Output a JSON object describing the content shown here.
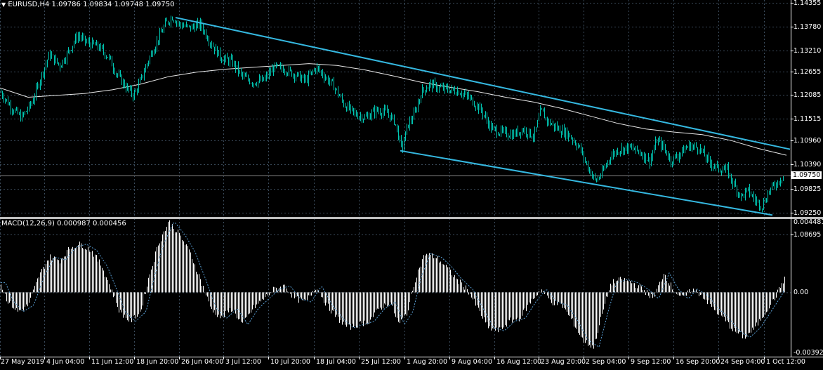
{
  "header": {
    "symbol_line": "EURUSD,H4  1.09786 1.09834 1.09748 1.09750",
    "macd_line": "MACD(12,26,9) 0.000987 0.000456"
  },
  "colors": {
    "background": "#000000",
    "grid": "#3a4a5a",
    "candle_up": "#00c8b4",
    "candle_down": "#00c8b4",
    "moving_average": "#e8e8e8",
    "trendline": "#35b8e0",
    "macd_histogram": "#ffffff",
    "macd_signal": "#5a9fd4",
    "price_tag_bg": "#ffffff",
    "price_tag_text": "#000000"
  },
  "chart_data": [
    {
      "type": "candlestick",
      "title": "EURUSD,H4",
      "ohlc_last": {
        "open": 1.09786,
        "high": 1.09834,
        "low": 1.09748,
        "close": 1.0975
      },
      "current_price": "1.09750",
      "ylim": [
        1.0865,
        1.1445
      ],
      "y_ticks": [
        "1.14355",
        "1.13780",
        "1.13210",
        "1.12655",
        "1.12085",
        "1.11515",
        "1.10960",
        "1.10390",
        "1.09825",
        "1.09250",
        "1.08695"
      ],
      "x_tick_labels": [
        "27 May 2019",
        "4 Jun 04:00",
        "11 Jun 12:00",
        "18 Jun 20:00",
        "26 Jun 04:00",
        "3 Jul 12:00",
        "10 Jul 20:00",
        "18 Jul 04:00",
        "25 Jul 12:00",
        "1 Aug 20:00",
        "9 Aug 04:00",
        "16 Aug 12:00",
        "23 Aug 20:00",
        "2 Sep 04:00",
        "9 Sep 12:00",
        "16 Sep 20:00",
        "24 Sep 04:00",
        "1 Oct 12:00"
      ],
      "close_path": [
        [
          0,
          1.12
        ],
        [
          15,
          1.116
        ],
        [
          30,
          1.113
        ],
        [
          45,
          1.117
        ],
        [
          60,
          1.125
        ],
        [
          70,
          1.13
        ],
        [
          85,
          1.127
        ],
        [
          95,
          1.13
        ],
        [
          110,
          1.135
        ],
        [
          125,
          1.133
        ],
        [
          140,
          1.132
        ],
        [
          155,
          1.129
        ],
        [
          165,
          1.125
        ],
        [
          180,
          1.121
        ],
        [
          190,
          1.119
        ],
        [
          200,
          1.123
        ],
        [
          210,
          1.128
        ],
        [
          222,
          1.133
        ],
        [
          235,
          1.138
        ],
        [
          245,
          1.14
        ],
        [
          255,
          1.138
        ],
        [
          270,
          1.137
        ],
        [
          285,
          1.138
        ],
        [
          300,
          1.133
        ],
        [
          315,
          1.129
        ],
        [
          330,
          1.128
        ],
        [
          345,
          1.124
        ],
        [
          360,
          1.1225
        ],
        [
          375,
          1.123
        ],
        [
          390,
          1.1265
        ],
        [
          405,
          1.126
        ],
        [
          420,
          1.1245
        ],
        [
          435,
          1.123
        ],
        [
          450,
          1.1265
        ],
        [
          460,
          1.1245
        ],
        [
          475,
          1.1215
        ],
        [
          490,
          1.1165
        ],
        [
          505,
          1.114
        ],
        [
          520,
          1.113
        ],
        [
          535,
          1.115
        ],
        [
          550,
          1.1145
        ],
        [
          562,
          1.112
        ],
        [
          572,
          1.1045
        ],
        [
          580,
          1.111
        ],
        [
          590,
          1.114
        ],
        [
          600,
          1.12
        ],
        [
          612,
          1.122
        ],
        [
          625,
          1.121
        ],
        [
          640,
          1.1205
        ],
        [
          655,
          1.12
        ],
        [
          670,
          1.118
        ],
        [
          685,
          1.115
        ],
        [
          700,
          1.11
        ],
        [
          715,
          1.109
        ],
        [
          730,
          1.1085
        ],
        [
          745,
          1.11
        ],
        [
          760,
          1.108
        ],
        [
          770,
          1.115
        ],
        [
          780,
          1.112
        ],
        [
          795,
          1.11
        ],
        [
          810,
          1.1085
        ],
        [
          825,
          1.105
        ],
        [
          835,
          1.1005
        ],
        [
          848,
          1.096
        ],
        [
          858,
          1.0985
        ],
        [
          868,
          1.1025
        ],
        [
          880,
          1.1045
        ],
        [
          895,
          1.105
        ],
        [
          910,
          1.104
        ],
        [
          925,
          1.1015
        ],
        [
          935,
          1.107
        ],
        [
          945,
          1.105
        ],
        [
          955,
          1.1015
        ],
        [
          965,
          1.103
        ],
        [
          980,
          1.1055
        ],
        [
          995,
          1.105
        ],
        [
          1010,
          1.101
        ],
        [
          1022,
          1.0995
        ],
        [
          1035,
          1.099
        ],
        [
          1045,
          1.095
        ],
        [
          1055,
          1.092
        ],
        [
          1065,
          1.0935
        ],
        [
          1075,
          1.091
        ],
        [
          1085,
          1.0895
        ],
        [
          1095,
          1.0935
        ],
        [
          1105,
          1.0955
        ],
        [
          1115,
          1.0975
        ]
      ],
      "moving_average": [
        [
          0,
          1.121
        ],
        [
          40,
          1.1185
        ],
        [
          80,
          1.119
        ],
        [
          120,
          1.1195
        ],
        [
          160,
          1.1205
        ],
        [
          200,
          1.122
        ],
        [
          240,
          1.124
        ],
        [
          280,
          1.1252
        ],
        [
          320,
          1.126
        ],
        [
          360,
          1.1265
        ],
        [
          400,
          1.127
        ],
        [
          440,
          1.1275
        ],
        [
          480,
          1.127
        ],
        [
          520,
          1.1258
        ],
        [
          560,
          1.1242
        ],
        [
          600,
          1.1225
        ],
        [
          640,
          1.1212
        ],
        [
          680,
          1.12
        ],
        [
          720,
          1.1185
        ],
        [
          760,
          1.1172
        ],
        [
          800,
          1.1155
        ],
        [
          840,
          1.1135
        ],
        [
          880,
          1.1115
        ],
        [
          920,
          1.11
        ],
        [
          960,
          1.1092
        ],
        [
          1000,
          1.1085
        ],
        [
          1040,
          1.107
        ],
        [
          1080,
          1.1048
        ],
        [
          1120,
          1.103
        ]
      ],
      "trendlines": [
        {
          "from": [
            250,
            1.1398
          ],
          "to": [
            1125,
            1.1046
          ]
        },
        {
          "from": [
            570,
            1.1042
          ],
          "to": [
            1100,
            1.087
          ]
        }
      ]
    },
    {
      "type": "macd_histogram",
      "title": "MACD(12,26,9)",
      "macd_value": 0.000987,
      "signal_value": 0.000456,
      "y_ticks": [
        "0.004481",
        "0.00",
        "-0.003925"
      ],
      "ylim": [
        -0.004,
        0.0046
      ],
      "histogram": [
        [
          0,
          0.0006
        ],
        [
          10,
          -0.0005
        ],
        [
          25,
          -0.0012
        ],
        [
          40,
          -0.0008
        ],
        [
          55,
          0.001
        ],
        [
          70,
          0.0022
        ],
        [
          85,
          0.002
        ],
        [
          100,
          0.0028
        ],
        [
          115,
          0.003
        ],
        [
          130,
          0.0026
        ],
        [
          145,
          0.0016
        ],
        [
          158,
          0.0002
        ],
        [
          170,
          -0.0012
        ],
        [
          185,
          -0.0018
        ],
        [
          200,
          -0.0012
        ],
        [
          212,
          0.001
        ],
        [
          225,
          0.003
        ],
        [
          240,
          0.0044
        ],
        [
          255,
          0.0036
        ],
        [
          270,
          0.0025
        ],
        [
          285,
          0.0008
        ],
        [
          300,
          -0.001
        ],
        [
          315,
          -0.0016
        ],
        [
          330,
          -0.001
        ],
        [
          345,
          -0.002
        ],
        [
          360,
          -0.001
        ],
        [
          375,
          -0.0004
        ],
        [
          390,
          0.0002
        ],
        [
          405,
          0.0004
        ],
        [
          420,
          -0.0004
        ],
        [
          435,
          -0.0006
        ],
        [
          450,
          0.0004
        ],
        [
          465,
          -0.0008
        ],
        [
          480,
          -0.0016
        ],
        [
          495,
          -0.0022
        ],
        [
          510,
          -0.002
        ],
        [
          525,
          -0.0018
        ],
        [
          540,
          -0.001
        ],
        [
          555,
          -0.0006
        ],
        [
          568,
          -0.002
        ],
        [
          580,
          -0.0012
        ],
        [
          592,
          0.001
        ],
        [
          605,
          0.0024
        ],
        [
          620,
          0.0022
        ],
        [
          635,
          0.0016
        ],
        [
          650,
          0.0008
        ],
        [
          665,
          0.0002
        ],
        [
          680,
          -0.001
        ],
        [
          695,
          -0.0022
        ],
        [
          710,
          -0.0024
        ],
        [
          725,
          -0.0018
        ],
        [
          740,
          -0.0016
        ],
        [
          755,
          -0.0006
        ],
        [
          770,
          0.0002
        ],
        [
          785,
          -0.0006
        ],
        [
          800,
          -0.0008
        ],
        [
          815,
          -0.0018
        ],
        [
          830,
          -0.003
        ],
        [
          845,
          -0.0034
        ],
        [
          858,
          -0.0012
        ],
        [
          870,
          0.0006
        ],
        [
          885,
          0.0008
        ],
        [
          900,
          0.0006
        ],
        [
          915,
          0.0002
        ],
        [
          930,
          -0.0004
        ],
        [
          945,
          0.0012
        ],
        [
          958,
          0.0002
        ],
        [
          972,
          -0.0004
        ],
        [
          985,
          0.0002
        ],
        [
          1000,
          -0.0002
        ],
        [
          1015,
          -0.001
        ],
        [
          1030,
          -0.0016
        ],
        [
          1045,
          -0.0024
        ],
        [
          1060,
          -0.0028
        ],
        [
          1075,
          -0.0022
        ],
        [
          1090,
          -0.0012
        ],
        [
          1105,
          -0.0002
        ],
        [
          1118,
          0.001
        ]
      ]
    }
  ]
}
